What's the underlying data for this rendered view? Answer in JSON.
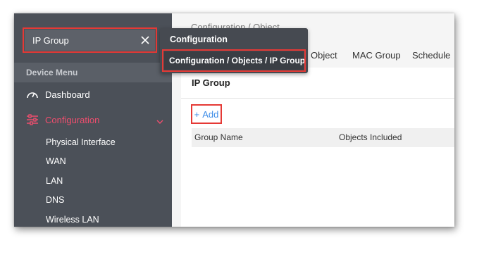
{
  "search": {
    "value": "IP Group"
  },
  "sidebar": {
    "header": "Device Menu",
    "items": [
      {
        "label": "Dashboard"
      },
      {
        "label": "Configuration"
      }
    ],
    "subitems": [
      {
        "label": "Physical Interface"
      },
      {
        "label": "WAN"
      },
      {
        "label": "LAN"
      },
      {
        "label": "DNS"
      },
      {
        "label": "Wireless LAN"
      }
    ]
  },
  "main": {
    "page_title": "Configuration / Object",
    "tabs": [
      {
        "label": "Object"
      },
      {
        "label": "MAC Group"
      },
      {
        "label": "Schedule"
      }
    ],
    "card_title": "IP Group",
    "add_label": "Add",
    "table_columns": [
      "Group Name",
      "Objects Included"
    ]
  },
  "popup": {
    "title": "Configuration",
    "result": "Configuration / Objects / IP Group"
  },
  "colors": {
    "sidebar_bg": "#4b5058",
    "active_nav": "#f04e6e",
    "link_blue": "#3f8ee8",
    "highlight_red": "#e53935"
  }
}
